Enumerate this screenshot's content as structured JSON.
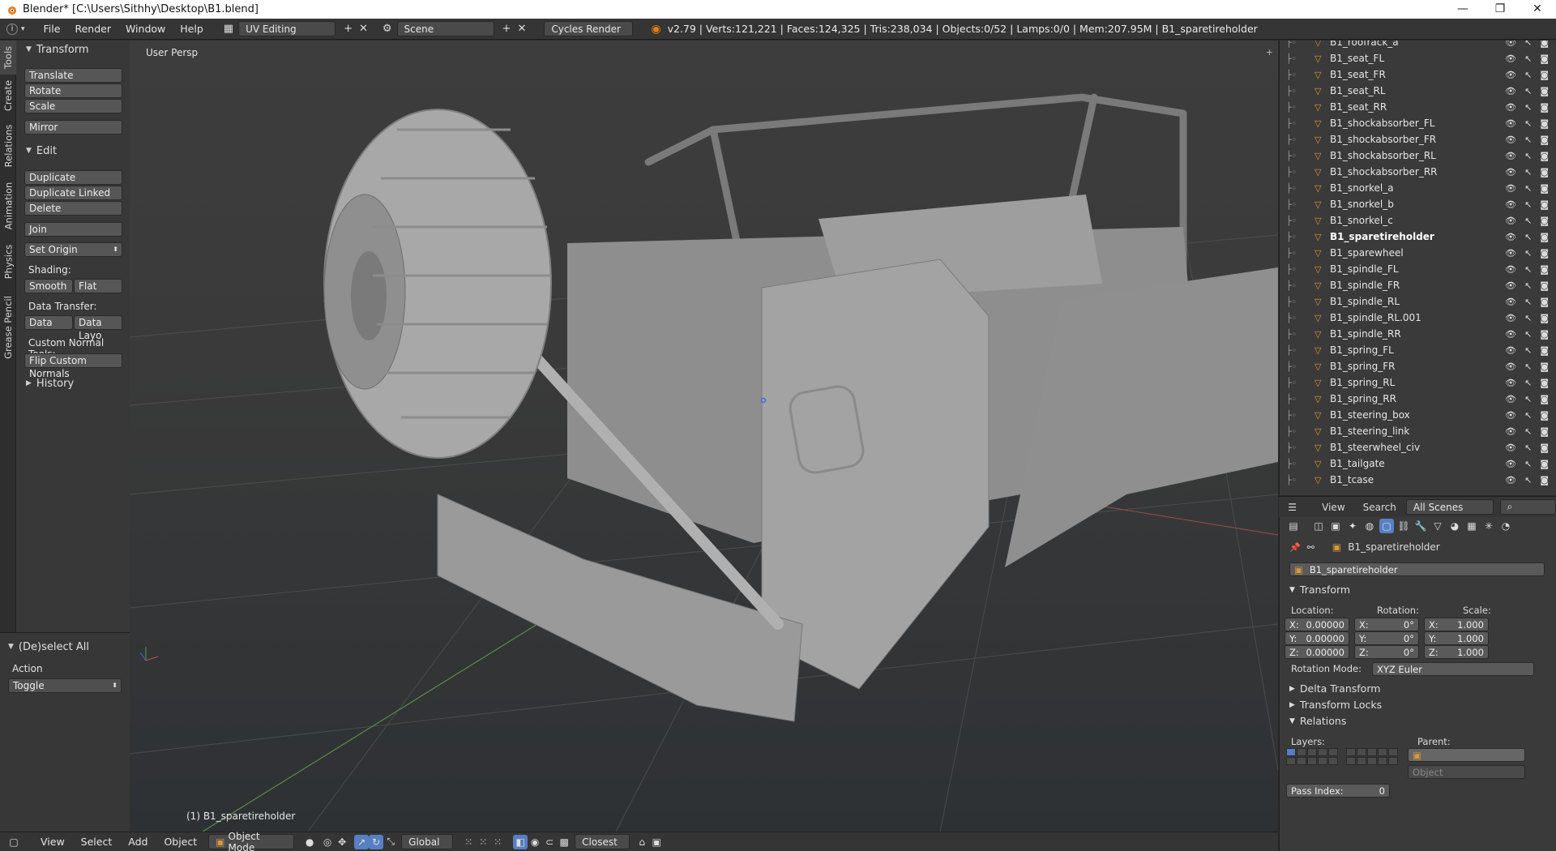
{
  "titlebar": {
    "title": "Blender* [C:\\Users\\Sithhy\\Desktop\\B1.blend]",
    "minimize": "—",
    "maximize": "❐",
    "close": "✕"
  },
  "infobar": {
    "info_icon": "i",
    "menus": [
      "File",
      "Render",
      "Window",
      "Help"
    ],
    "layout": "UV Editing",
    "scene": "Scene",
    "engine": "Cycles Render",
    "stats": "v2.79 | Verts:121,221 | Faces:124,325 | Tris:238,034 | Objects:0/52 | Lamps:0/0 | Mem:207.95M | B1_sparetireholder"
  },
  "toolshelf": {
    "tabs": [
      "Tools",
      "Create",
      "Relations",
      "Animation",
      "Physics",
      "Grease Pencil"
    ],
    "transform_header": "Transform",
    "translate": "Translate",
    "rotate": "Rotate",
    "scale": "Scale",
    "mirror": "Mirror",
    "edit_header": "Edit",
    "duplicate": "Duplicate",
    "duplicate_linked": "Duplicate Linked",
    "delete": "Delete",
    "join": "Join",
    "set_origin": "Set Origin",
    "shading_label": "Shading:",
    "smooth": "Smooth",
    "flat": "Flat",
    "data_transfer_label": "Data Transfer:",
    "data": "Data",
    "data_layo": "Data Layo",
    "custom_normal_label": "Custom Normal Tools:",
    "flip_custom_normals": "Flip Custom Normals",
    "history": "History"
  },
  "last_operator": {
    "title": "(De)select All",
    "action_label": "Action",
    "action_value": "Toggle"
  },
  "viewport": {
    "view_name": "User Persp",
    "active_object": "(1) B1_sparetireholder"
  },
  "outliner": {
    "items": [
      "B1_roofrack_a",
      "B1_seat_FL",
      "B1_seat_FR",
      "B1_seat_RL",
      "B1_seat_RR",
      "B1_shockabsorber_FL",
      "B1_shockabsorber_FR",
      "B1_shockabsorber_RL",
      "B1_shockabsorber_RR",
      "B1_snorkel_a",
      "B1_snorkel_b",
      "B1_snorkel_c",
      "B1_sparetireholder",
      "B1_sparewheel",
      "B1_spindle_FL",
      "B1_spindle_FR",
      "B1_spindle_RL",
      "B1_spindle_RL.001",
      "B1_spindle_RR",
      "B1_spring_FL",
      "B1_spring_FR",
      "B1_spring_RL",
      "B1_spring_RR",
      "B1_steering_box",
      "B1_steering_link",
      "B1_steerwheel_civ",
      "B1_tailgate",
      "B1_tcase"
    ],
    "selected": "B1_sparetireholder",
    "header_view": "View",
    "header_search": "Search",
    "header_scenes": "All Scenes"
  },
  "properties": {
    "context_object": "B1_sparetireholder",
    "object_name": "B1_sparetireholder",
    "transform_header": "Transform",
    "location_label": "Location:",
    "rotation_label": "Rotation:",
    "scale_label": "Scale:",
    "location": [
      {
        "axis": "X:",
        "value": "0.00000"
      },
      {
        "axis": "Y:",
        "value": "0.00000"
      },
      {
        "axis": "Z:",
        "value": "0.00000"
      }
    ],
    "rotation": [
      {
        "axis": "X:",
        "value": "0°"
      },
      {
        "axis": "Y:",
        "value": "0°"
      },
      {
        "axis": "Z:",
        "value": "0°"
      }
    ],
    "scale": [
      {
        "axis": "X:",
        "value": "1.000"
      },
      {
        "axis": "Y:",
        "value": "1.000"
      },
      {
        "axis": "Z:",
        "value": "1.000"
      }
    ],
    "rotation_mode_label": "Rotation Mode:",
    "rotation_mode": "XYZ Euler",
    "delta_transform": "Delta Transform",
    "transform_locks": "Transform Locks",
    "relations": "Relations",
    "layers_label": "Layers:",
    "parent_label": "Parent:",
    "parent_type": "Object",
    "pass_index_label": "Pass Index:",
    "pass_index": "0"
  },
  "bottombar": {
    "menus": [
      "View",
      "Select",
      "Add",
      "Object"
    ],
    "mode": "Object Mode",
    "orientation": "Global",
    "snap": "Closest"
  },
  "colors": {
    "accent": "#5680c2",
    "object_icon": "#d89a3a",
    "selected": "#ffffff"
  }
}
